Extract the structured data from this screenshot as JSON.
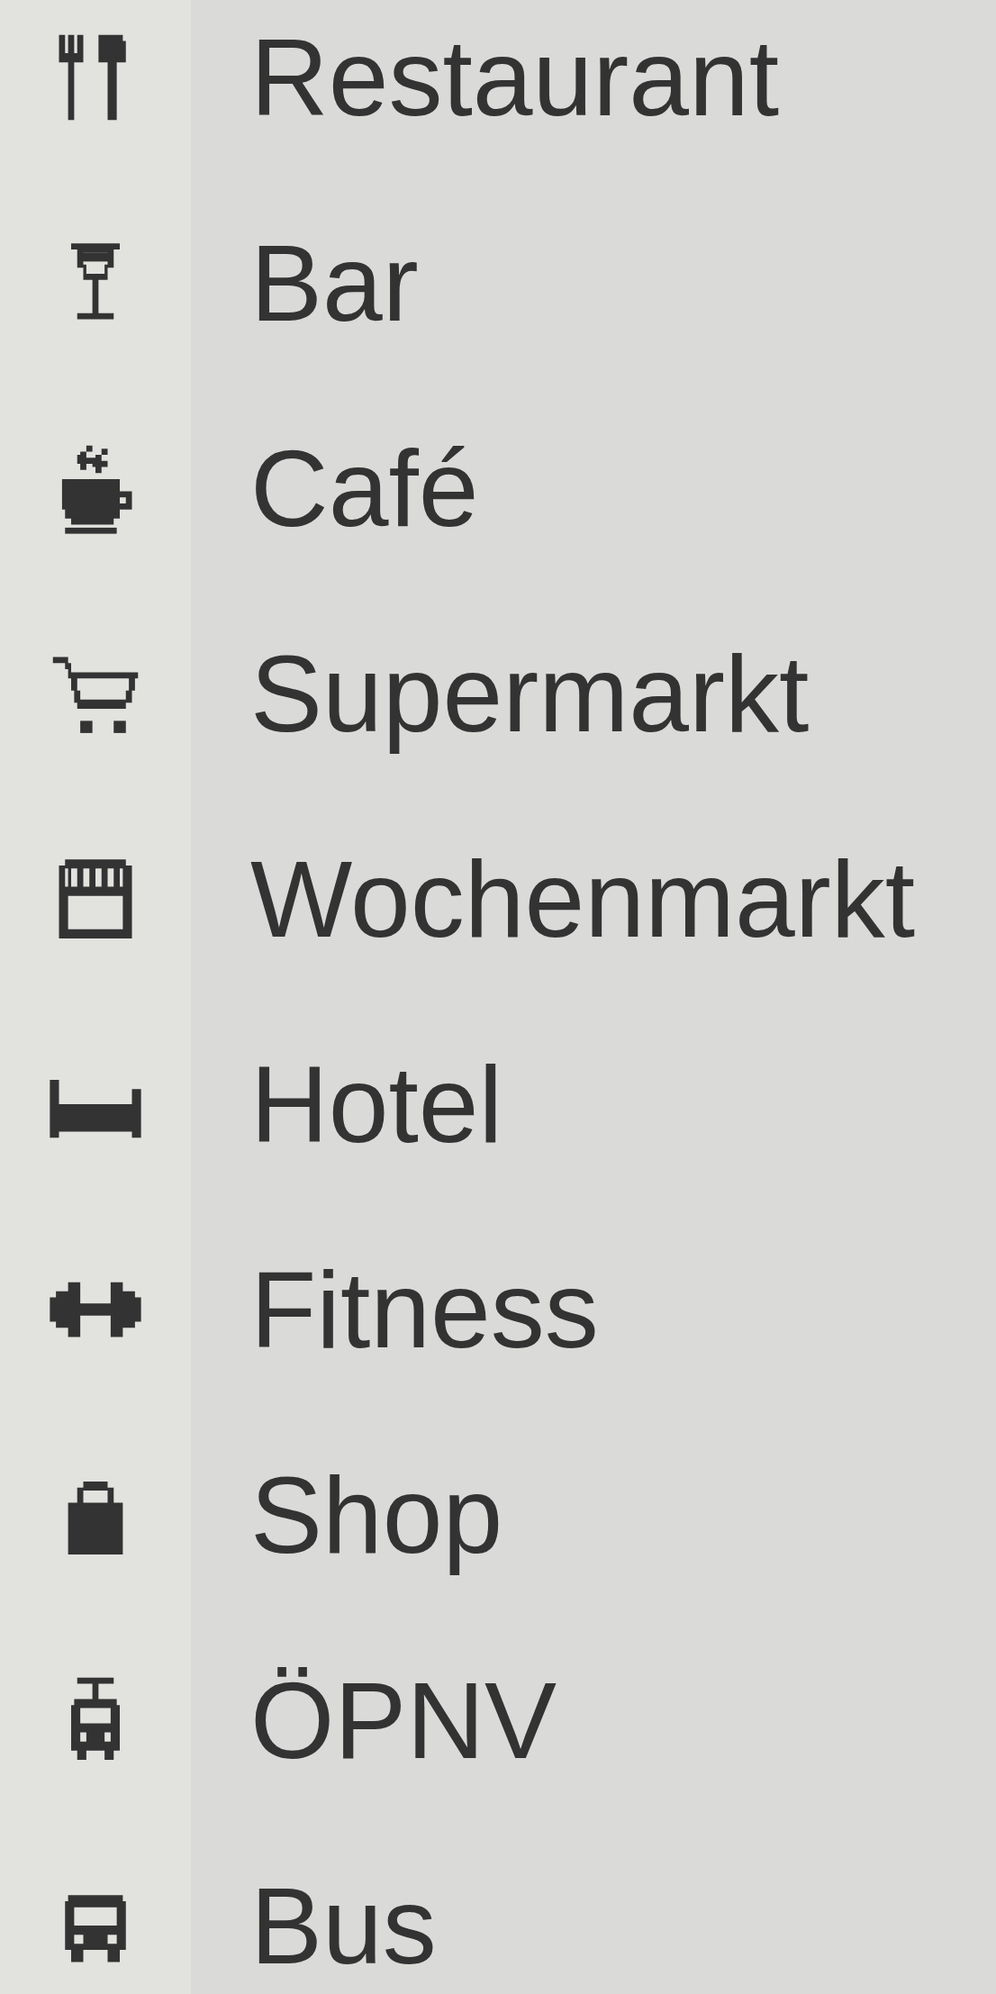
{
  "items": [
    {
      "kind": "restaurant",
      "label": "Restaurant"
    },
    {
      "kind": "bar",
      "label": "Bar"
    },
    {
      "kind": "cafe",
      "label": "Café"
    },
    {
      "kind": "supermarket",
      "label": "Supermarkt"
    },
    {
      "kind": "market",
      "label": "Wochenmarkt"
    },
    {
      "kind": "hotel",
      "label": "Hotel"
    },
    {
      "kind": "fitness",
      "label": "Fitness"
    },
    {
      "kind": "shop",
      "label": "Shop"
    },
    {
      "kind": "transit",
      "label": "ÖPNV"
    },
    {
      "kind": "bus",
      "label": "Bus"
    }
  ]
}
